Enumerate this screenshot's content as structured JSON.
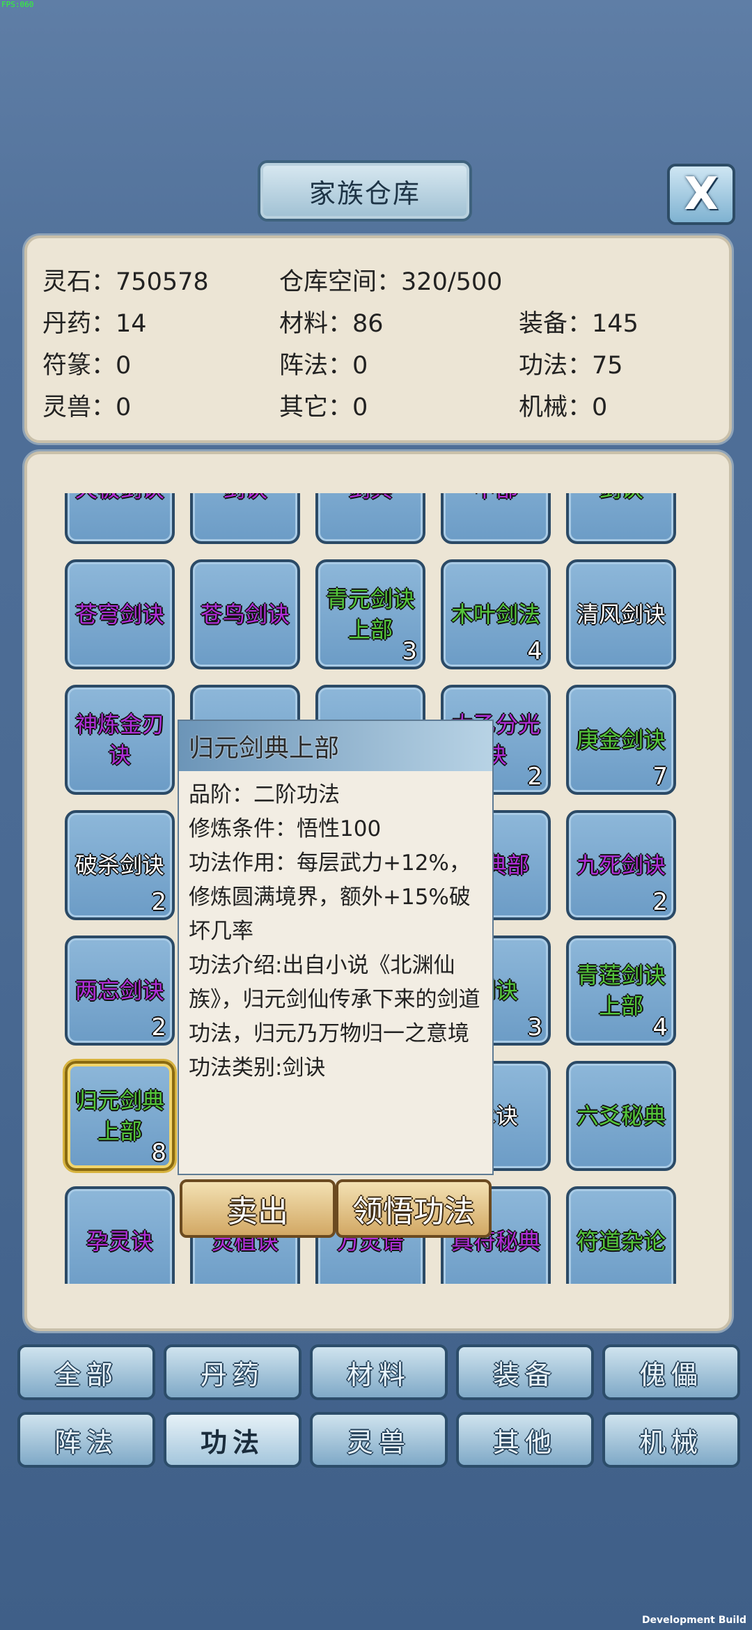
{
  "debug": {
    "fps": "FPS:060",
    "build": "Development Build"
  },
  "header": {
    "title": "家族仓库",
    "close": "X"
  },
  "stats": {
    "spirit_stone": {
      "label": "灵石",
      "value": "750578"
    },
    "capacity": {
      "label": "仓库空间",
      "value": "320/500"
    },
    "pill": {
      "label": "丹药",
      "value": "14"
    },
    "material": {
      "label": "材料",
      "value": "86"
    },
    "equipment": {
      "label": "装备",
      "value": "145"
    },
    "talisman": {
      "label": "符篆",
      "value": "0"
    },
    "formation": {
      "label": "阵法",
      "value": "0"
    },
    "technique": {
      "label": "功法",
      "value": "75"
    },
    "beast": {
      "label": "灵兽",
      "value": "0"
    },
    "other": {
      "label": "其它",
      "value": "0"
    },
    "machine": {
      "label": "机械",
      "value": "0"
    }
  },
  "items": [
    {
      "name": "天极剑诀",
      "color": "purple",
      "count": ""
    },
    {
      "name": "剑诀",
      "color": "purple",
      "count": ""
    },
    {
      "name": "剑典",
      "color": "purple",
      "count": ""
    },
    {
      "name": "中部",
      "color": "purple",
      "count": ""
    },
    {
      "name": "剑诀",
      "color": "green",
      "count": ""
    },
    {
      "name": "苍穹剑诀",
      "color": "purple",
      "count": ""
    },
    {
      "name": "苍鸟剑诀",
      "color": "purple",
      "count": ""
    },
    {
      "name": "青元剑诀上部",
      "color": "green",
      "count": "3"
    },
    {
      "name": "木叶剑法",
      "color": "green",
      "count": "4"
    },
    {
      "name": "清风剑诀",
      "color": "white",
      "count": ""
    },
    {
      "name": "神炼金刃诀",
      "color": "purple",
      "count": ""
    },
    {
      "name": "",
      "color": "purple",
      "count": ""
    },
    {
      "name": "",
      "color": "purple",
      "count": ""
    },
    {
      "name": "太乙分光诀",
      "color": "purple",
      "count": "2"
    },
    {
      "name": "庚金剑诀",
      "color": "green",
      "count": "7"
    },
    {
      "name": "破杀剑诀",
      "color": "white",
      "count": "2"
    },
    {
      "name": "",
      "color": "purple",
      "count": ""
    },
    {
      "name": "",
      "color": "purple",
      "count": ""
    },
    {
      "name": "剑典部",
      "color": "purple",
      "count": ""
    },
    {
      "name": "九死剑诀",
      "color": "purple",
      "count": "2"
    },
    {
      "name": "两忘剑诀",
      "color": "purple",
      "count": "2"
    },
    {
      "name": "",
      "color": "purple",
      "count": ""
    },
    {
      "name": "",
      "color": "purple",
      "count": ""
    },
    {
      "name": "剑诀",
      "color": "green",
      "count": "3"
    },
    {
      "name": "青莲剑诀上部",
      "color": "green",
      "count": "4"
    },
    {
      "name": "归元剑典上部",
      "color": "green",
      "count": "8"
    },
    {
      "name": "",
      "color": "purple",
      "count": ""
    },
    {
      "name": "",
      "color": "purple",
      "count": ""
    },
    {
      "name": "术诀",
      "color": "white",
      "count": ""
    },
    {
      "name": "六爻秘典",
      "color": "green",
      "count": ""
    },
    {
      "name": "孕灵诀",
      "color": "purple",
      "count": ""
    },
    {
      "name": "灵植诀",
      "color": "purple",
      "count": ""
    },
    {
      "name": "万灵谱",
      "color": "purple",
      "count": ""
    },
    {
      "name": "真符秘典",
      "color": "purple",
      "count": ""
    },
    {
      "name": "符道杂论",
      "color": "green",
      "count": ""
    }
  ],
  "tooltip": {
    "title": "归元剑典上部",
    "lines": [
      "品阶：二阶功法",
      "修炼条件：悟性100",
      "功法作用：每层武力+12%，修炼圆满境界，额外+15%破坏几率",
      "功法介绍:出自小说《北渊仙族》，归元剑仙传承下来的剑道功法，归元乃万物归一之意境",
      "功法类别:剑诀"
    ]
  },
  "actions": {
    "sell": "卖出",
    "learn": "领悟功法"
  },
  "tabs": [
    {
      "label": "全部",
      "active": false
    },
    {
      "label": "丹药",
      "active": false
    },
    {
      "label": "材料",
      "active": false
    },
    {
      "label": "装备",
      "active": false
    },
    {
      "label": "傀儡",
      "active": false
    },
    {
      "label": "阵法",
      "active": false
    },
    {
      "label": "功法",
      "active": true
    },
    {
      "label": "灵兽",
      "active": false
    },
    {
      "label": "其他",
      "active": false
    },
    {
      "label": "机械",
      "active": false
    }
  ]
}
